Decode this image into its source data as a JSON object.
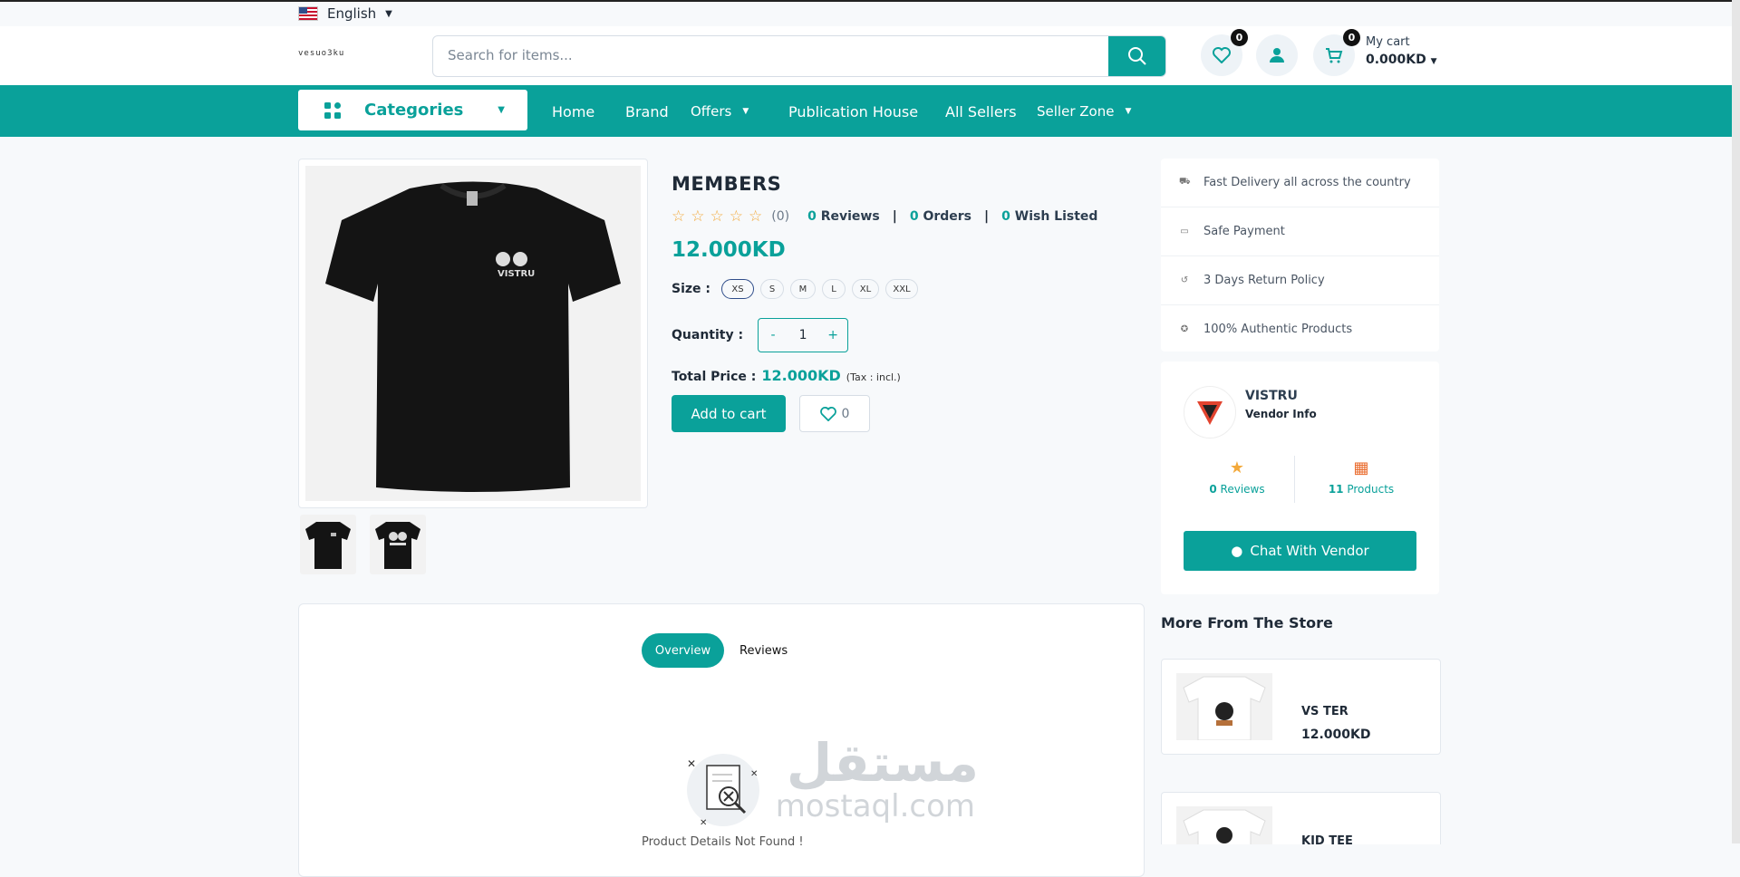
{
  "topbar": {
    "language": "English"
  },
  "header": {
    "logo_text": "vesuo3ku",
    "search": {
      "placeholder": "Search for items...",
      "value": ""
    },
    "wishlist_count": "0",
    "cart_count": "0",
    "cart_label": "My cart",
    "cart_total": "0.000KD"
  },
  "nav": {
    "categories": "Categories",
    "items": [
      "Home",
      "Brand",
      "Offers",
      "Publication House",
      "All Sellers",
      "Seller Zone"
    ]
  },
  "product": {
    "title": "MEMBERS",
    "rating_count": "(0)",
    "reviews_num": "0",
    "reviews_label": "Reviews",
    "orders_num": "0",
    "orders_label": "Orders",
    "wish_num": "0",
    "wish_label": "Wish Listed",
    "price": "12.000KD",
    "size_label": "Size :",
    "sizes": [
      "XS",
      "S",
      "M",
      "L",
      "XL",
      "XXL"
    ],
    "selected_size": "XS",
    "quantity_label": "Quantity :",
    "quantity": "1",
    "qty_minus": "-",
    "qty_plus": "+",
    "total_label": "Total Price :",
    "total_value": "12.000KD",
    "tax_note": "(Tax : incl.)",
    "add_to_cart": "Add to cart",
    "wish_count": "0",
    "image_brand": "VISTRU"
  },
  "features": [
    "Fast Delivery all across the country",
    "Safe Payment",
    "3 Days Return Policy",
    "100% Authentic Products"
  ],
  "vendor": {
    "name": "VISTRU",
    "info": "Vendor Info",
    "reviews_num": "0",
    "reviews_label": "Reviews",
    "products_num": "11",
    "products_label": "Products",
    "chat": "Chat With Vendor"
  },
  "more_store": {
    "title": "More From The Store",
    "items": [
      {
        "name": "VS TER",
        "price": "12.000KD"
      },
      {
        "name": "KID TEE",
        "price": ""
      }
    ]
  },
  "details": {
    "tabs": [
      "Overview",
      "Reviews"
    ],
    "empty_text": "Product Details Not Found !"
  },
  "watermark": {
    "arabic": "مستقل",
    "latin": "mostaql.com"
  },
  "colors": {
    "accent": "#0aa19a",
    "star": "#f3a93b",
    "dark": "#1f2a37"
  }
}
